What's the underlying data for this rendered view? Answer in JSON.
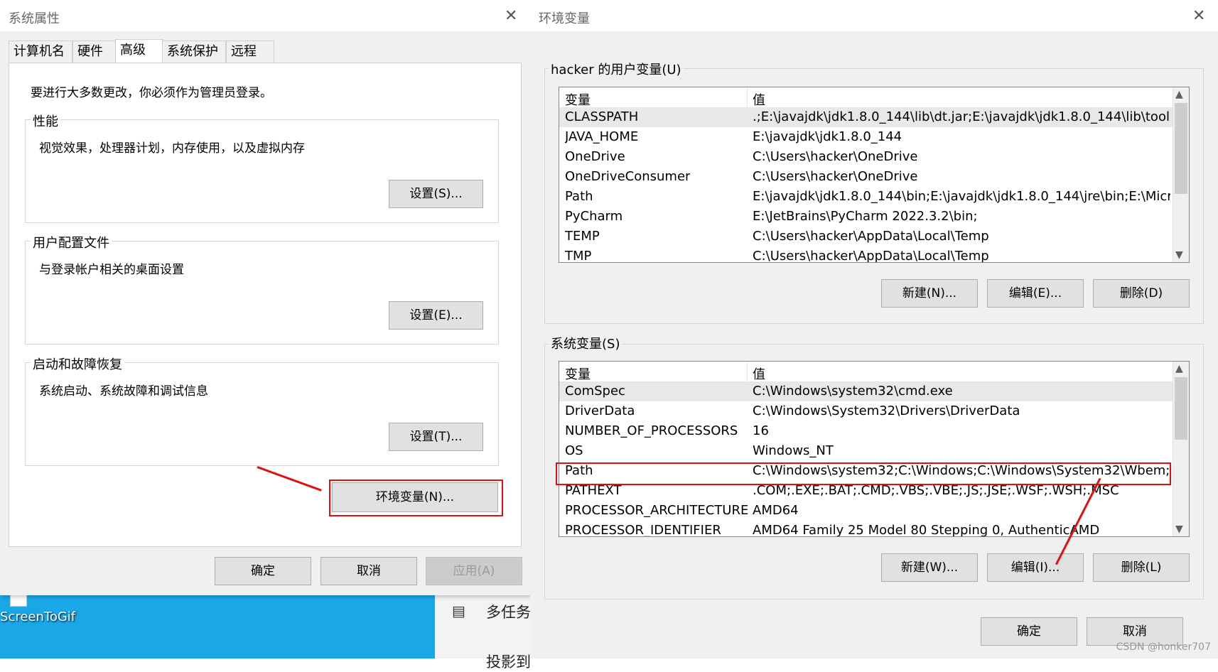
{
  "desktop": {
    "icon_name": "screentogif-icon",
    "icon_label": "ScreenToGif",
    "settings_items": [
      "多任务",
      "投影到"
    ]
  },
  "system_properties": {
    "title": "系统属性",
    "tabs": [
      "计算机名",
      "硬件",
      "高级",
      "系统保护",
      "远程"
    ],
    "active_tab": "高级",
    "intro": "要进行大多数更改，你必须作为管理员登录。",
    "groups": [
      {
        "label": "性能",
        "desc": "视觉效果，处理器计划，内存使用，以及虚拟内存",
        "button": "设置(S)..."
      },
      {
        "label": "用户配置文件",
        "desc": "与登录帐户相关的桌面设置",
        "button": "设置(E)..."
      },
      {
        "label": "启动和故障恢复",
        "desc": "系统启动、系统故障和调试信息",
        "button": "设置(T)..."
      }
    ],
    "env_button": "环境变量(N)...",
    "ok": "确定",
    "cancel": "取消",
    "apply": "应用(A)"
  },
  "env_vars": {
    "title": "环境变量",
    "user_section": "hacker 的用户变量(U)",
    "system_section": "系统变量(S)",
    "col_var": "变量",
    "col_val": "值",
    "user_rows": [
      {
        "name": "CLASSPATH",
        "value": ".;E:\\javajdk\\jdk1.8.0_144\\lib\\dt.jar;E:\\javajdk\\jdk1.8.0_144\\lib\\tools...."
      },
      {
        "name": "JAVA_HOME",
        "value": "E:\\javajdk\\jdk1.8.0_144"
      },
      {
        "name": "OneDrive",
        "value": "C:\\Users\\hacker\\OneDrive"
      },
      {
        "name": "OneDriveConsumer",
        "value": "C:\\Users\\hacker\\OneDrive"
      },
      {
        "name": "Path",
        "value": "E:\\javajdk\\jdk1.8.0_144\\bin;E:\\javajdk\\jdk1.8.0_144\\jre\\bin;E:\\Micr..."
      },
      {
        "name": "PyCharm",
        "value": "E:\\JetBrains\\PyCharm 2022.3.2\\bin;"
      },
      {
        "name": "TEMP",
        "value": "C:\\Users\\hacker\\AppData\\Local\\Temp"
      },
      {
        "name": "TMP",
        "value": "C:\\Users\\hacker\\AppData\\Local\\Temp"
      }
    ],
    "system_rows": [
      {
        "name": "ComSpec",
        "value": "C:\\Windows\\system32\\cmd.exe"
      },
      {
        "name": "DriverData",
        "value": "C:\\Windows\\System32\\Drivers\\DriverData"
      },
      {
        "name": "NUMBER_OF_PROCESSORS",
        "value": "16"
      },
      {
        "name": "OS",
        "value": "Windows_NT"
      },
      {
        "name": "Path",
        "value": "C:\\Windows\\system32;C:\\Windows;C:\\Windows\\System32\\Wbem;..."
      },
      {
        "name": "PATHEXT",
        "value": ".COM;.EXE;.BAT;.CMD;.VBS;.VBE;.JS;.JSE;.WSF;.WSH;.MSC"
      },
      {
        "name": "PROCESSOR_ARCHITECTURE",
        "value": "AMD64"
      },
      {
        "name": "PROCESSOR_IDENTIFIER",
        "value": "AMD64 Family 25 Model 80 Stepping 0, AuthenticAMD"
      }
    ],
    "user_buttons": [
      "新建(N)...",
      "编辑(E)...",
      "删除(D)"
    ],
    "system_buttons": [
      "新建(W)...",
      "编辑(I)...",
      "删除(L)"
    ],
    "ok": "确定",
    "cancel": "取消"
  },
  "watermark": "CSDN @honker707",
  "colors": {
    "highlight": "#e01010",
    "desktop": "#1aa7e8"
  }
}
